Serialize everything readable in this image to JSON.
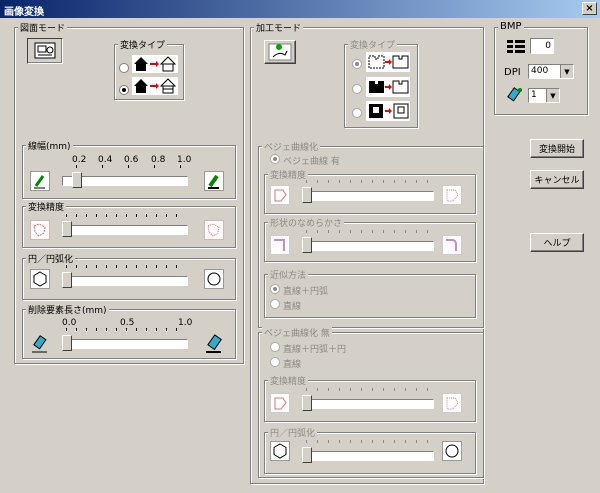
{
  "window": {
    "title": "画像変換",
    "close": "×"
  },
  "zumen": {
    "group": "図面モード",
    "henkan_type": "変換タイプ",
    "senpuku": {
      "title": "線幅(mm)",
      "ticks": [
        "0.2",
        "0.4",
        "0.6",
        "0.8",
        "1.0"
      ]
    },
    "seido": "変換精度",
    "en": "円／円弧化",
    "sakujo": {
      "title": "削除要素長さ(mm)",
      "ticks": [
        "0.0",
        "0.5",
        "1.0"
      ]
    }
  },
  "kako": {
    "group": "加工モード",
    "henkan_type": "変換タイプ",
    "bezier_on": {
      "title": "ベジェ曲線化",
      "radio": "ベジェ曲線 有",
      "seido": "変換精度",
      "smooth": "形状のなめらかさ",
      "kinji": {
        "title": "近似方法",
        "opt1": "直線＋円弧",
        "opt2": "直線"
      }
    },
    "bezier_off": {
      "title": "ベジェ曲線化 無",
      "opt1": "直線＋円弧＋円",
      "opt2": "直線",
      "seido": "変換精度",
      "en": "円／円弧化"
    }
  },
  "bmp": {
    "group": "BMP",
    "count": "0",
    "dpi_label": "DPI",
    "dpi": "400",
    "pen": "1"
  },
  "buttons": {
    "start": "変換開始",
    "cancel": "キャンセル",
    "help": "ヘルプ"
  }
}
